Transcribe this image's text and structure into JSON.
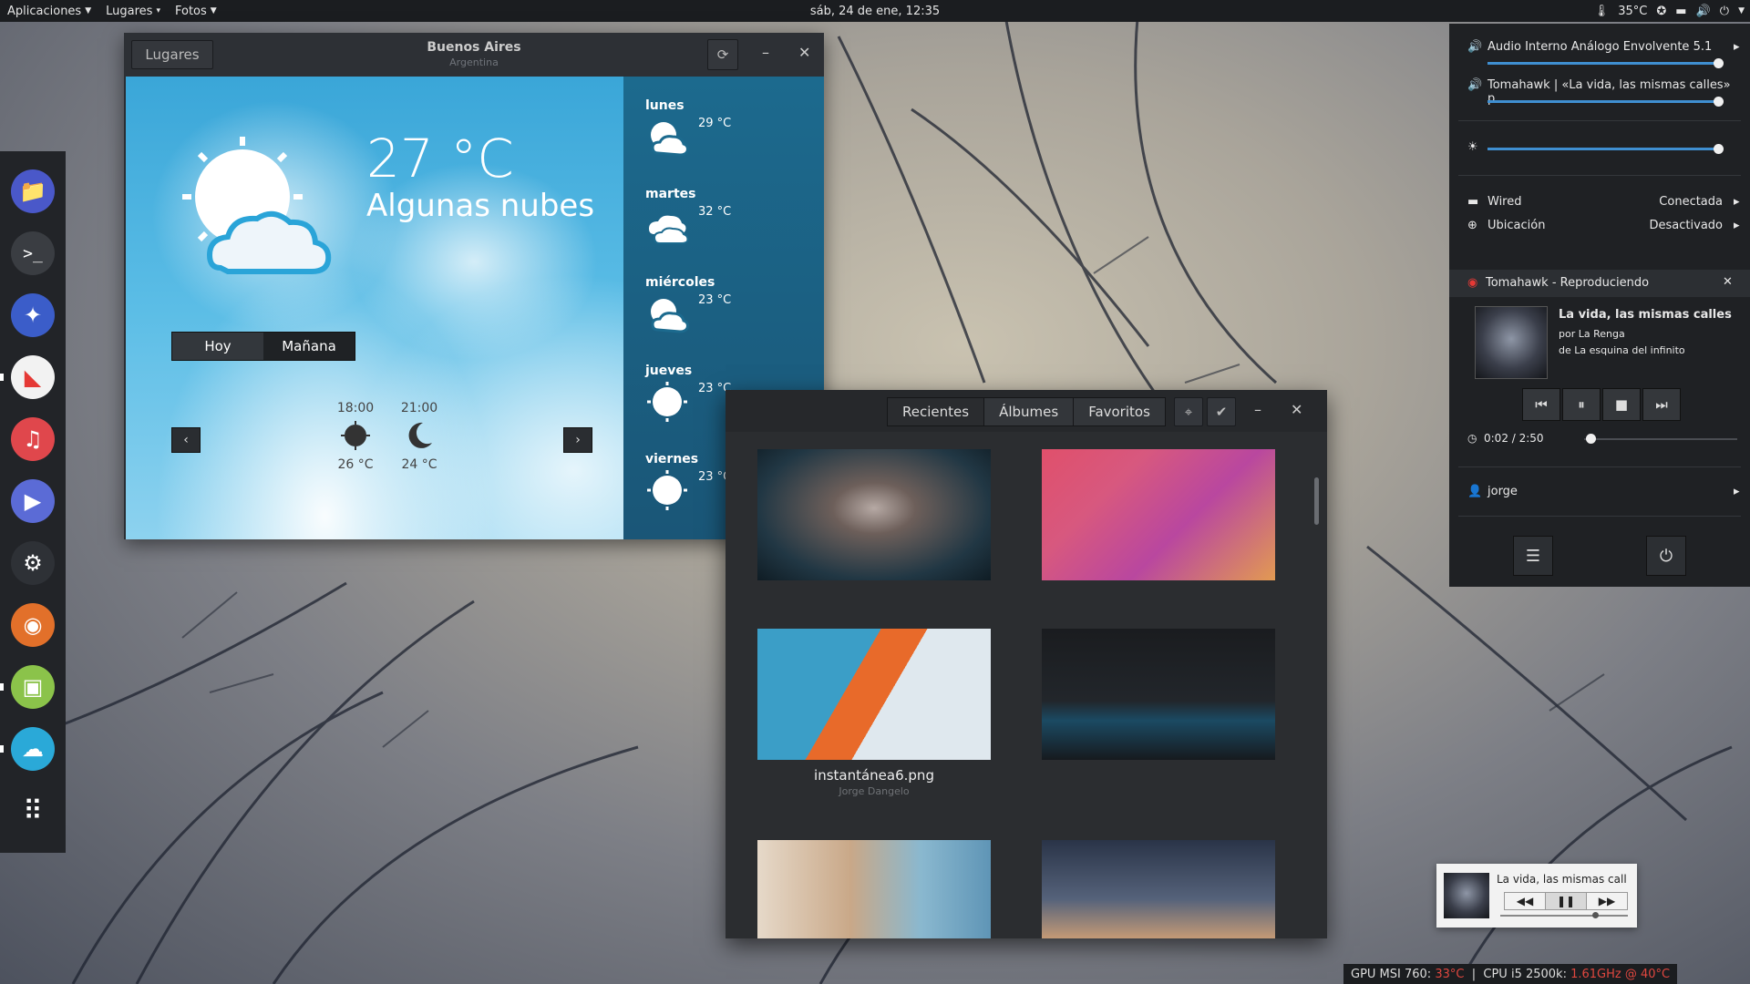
{
  "topbar": {
    "menus": [
      "Aplicaciones",
      "Lugares",
      "Fotos"
    ],
    "clock": "sáb, 24 de ene, 12:35",
    "temperature": "35°C"
  },
  "dock": {
    "apps": [
      {
        "name": "files",
        "color": "#4a58c9",
        "glyph": "📁"
      },
      {
        "name": "terminal",
        "color": "#3a3d42",
        "glyph": ">_"
      },
      {
        "name": "web-browser",
        "color": "#3b5dc9",
        "glyph": "✦"
      },
      {
        "name": "tomahawk",
        "color": "#e53935",
        "glyph": "◣"
      },
      {
        "name": "music",
        "color": "#e0474c",
        "glyph": "♫"
      },
      {
        "name": "video-player",
        "color": "#5b6bd6",
        "glyph": "▶"
      },
      {
        "name": "steam",
        "color": "#2e3136",
        "glyph": "⚙"
      },
      {
        "name": "firefox",
        "color": "#e2702a",
        "glyph": "◉"
      },
      {
        "name": "photos",
        "color": "#8bc34a",
        "glyph": "▣"
      },
      {
        "name": "weather",
        "color": "#2aa9d8",
        "glyph": "☁"
      }
    ]
  },
  "weather": {
    "places_button": "Lugares",
    "city": "Buenos Aires",
    "country": "Argentina",
    "current_temp": "27 °C",
    "condition": "Algunas nubes",
    "tab_today": "Hoy",
    "tab_tomorrow": "Mañana",
    "hours": [
      {
        "time": "18:00",
        "temp": "26 °C",
        "icon": "sun-icon"
      },
      {
        "time": "21:00",
        "temp": "24 °C",
        "icon": "moon-icon"
      }
    ],
    "forecast": [
      {
        "day": "lunes",
        "temp": "29 °C",
        "icon": "sun-cloud-icon"
      },
      {
        "day": "martes",
        "temp": "32 °C",
        "icon": "clouds-icon"
      },
      {
        "day": "miércoles",
        "temp": "23 °C",
        "icon": "sun-cloud-icon"
      },
      {
        "day": "jueves",
        "temp": "23 °C",
        "icon": "sun-icon"
      },
      {
        "day": "viernes",
        "temp": "23 °C",
        "icon": "sun-icon"
      }
    ]
  },
  "photos": {
    "tabs": [
      "Recientes",
      "Álbumes",
      "Favoritos"
    ],
    "items": [
      {
        "caption": "",
        "author": ""
      },
      {
        "caption": "",
        "author": ""
      },
      {
        "caption": "instantánea6.png",
        "author": "Jorge Dangelo"
      },
      {
        "caption": "",
        "author": ""
      },
      {
        "caption": "",
        "author": ""
      },
      {
        "caption": "",
        "author": ""
      }
    ]
  },
  "sysmenu": {
    "audio_output": "Audio Interno Análogo Envolvente 5.1",
    "app_volume": "Tomahawk | «La vida, las mismas calles» p...",
    "wired_label": "Wired",
    "wired_status": "Conectada",
    "location_label": "Ubicación",
    "location_status": "Desactivado",
    "player_header": "Tomahawk - Reproduciendo",
    "track_title": "La vida, las mismas calles",
    "track_artist": "por La Renga",
    "track_album": "de La esquina del infinito",
    "track_time": "0:02 / 2:50",
    "track_progress": 0.012,
    "user": "jorge"
  },
  "mini_player": {
    "title": "La vida, las mismas call",
    "progress": 0.75
  },
  "status_bar": {
    "gpu_label": "GPU MSI 760:",
    "gpu_value": "33°C",
    "cpu_label": "CPU i5 2500k:",
    "cpu_value": "1.61GHz @ 40°C"
  },
  "colors": {
    "accent": "#3f8fd1",
    "alert": "#e0473f"
  }
}
